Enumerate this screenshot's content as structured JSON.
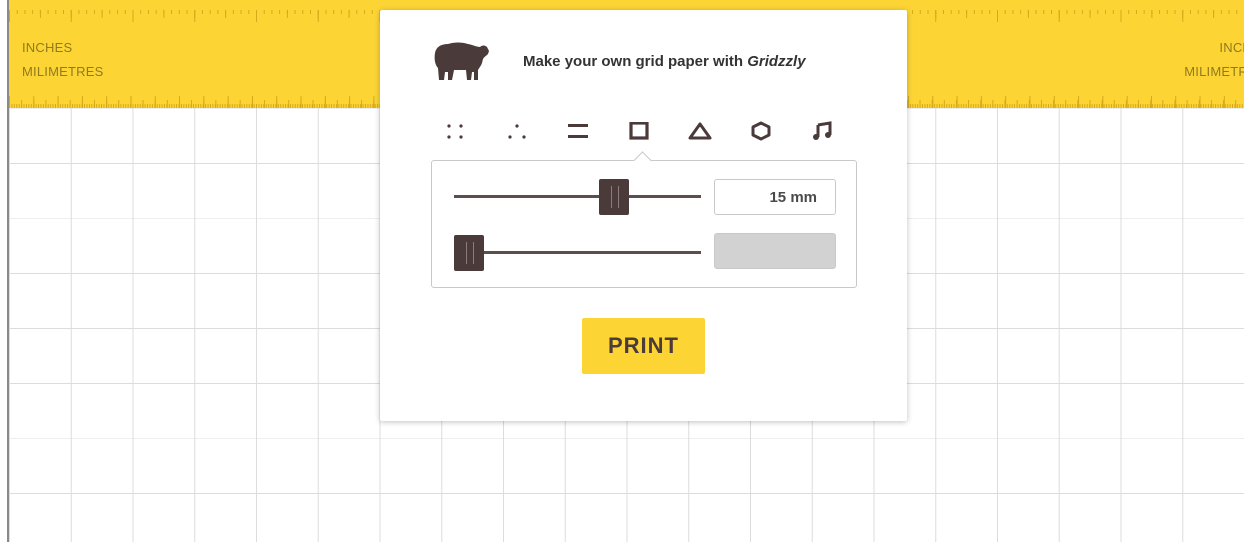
{
  "ruler": {
    "label_inches": "INCHES",
    "label_mm": "MILIMETRES",
    "label_inches_right": "INCH",
    "label_mm_right": "MILIMETR"
  },
  "brand": {
    "tagline_prefix": "Make your own grid paper with ",
    "tagline_name": "Gridzzly",
    "logo_icon": "bear-icon"
  },
  "shape_tabs": [
    {
      "name": "square-dots",
      "icon": "square-dots-icon",
      "selected": false
    },
    {
      "name": "triangle-dots",
      "icon": "triangle-dots-icon",
      "selected": false
    },
    {
      "name": "lines",
      "icon": "lines-icon",
      "selected": false
    },
    {
      "name": "squares",
      "icon": "square-icon",
      "selected": true
    },
    {
      "name": "triangles",
      "icon": "triangle-icon",
      "selected": false
    },
    {
      "name": "hexagons",
      "icon": "hexagon-icon",
      "selected": false
    },
    {
      "name": "music",
      "icon": "music-note-icon",
      "selected": false
    }
  ],
  "controls": {
    "size_value": "15 mm",
    "size_slider_level": 0.6,
    "second_slider_level": 0.0,
    "second_value": ""
  },
  "print_button": {
    "label": "PRINT"
  },
  "colors": {
    "accent": "#fcd535",
    "brand_brown": "#4a3a3a",
    "grid_line": "#dcdcdc"
  }
}
